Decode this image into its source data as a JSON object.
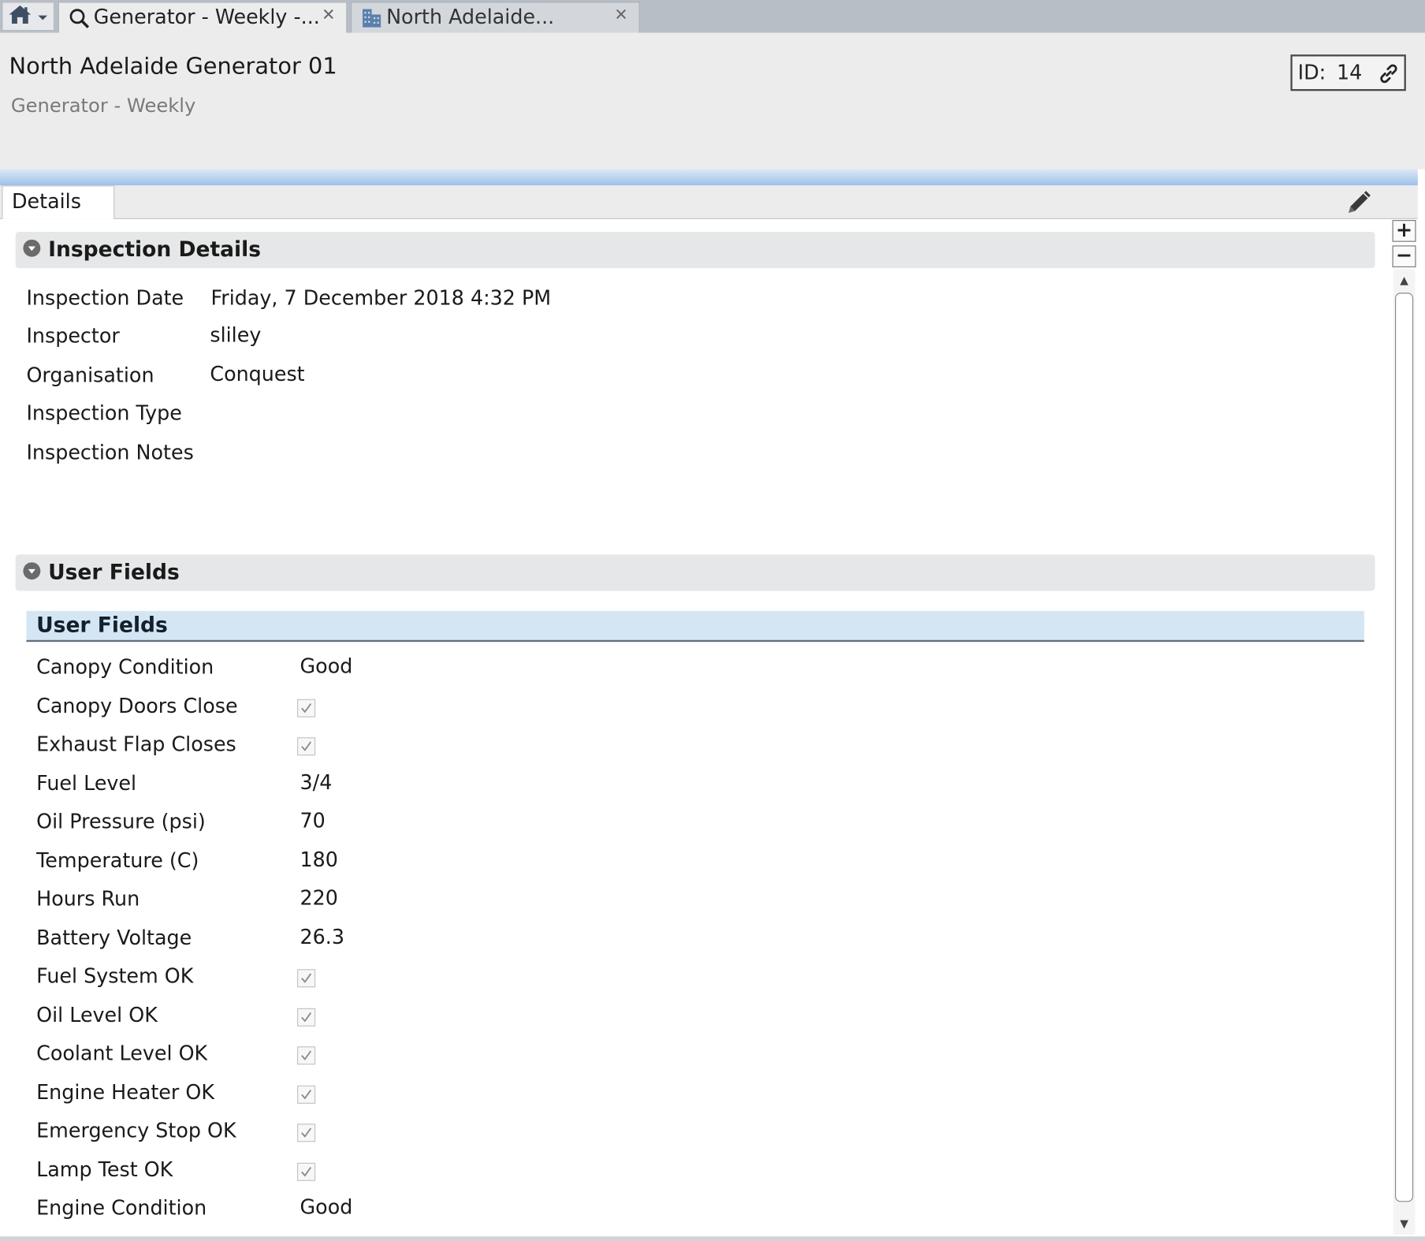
{
  "tabs": [
    {
      "label": "Generator - Weekly -...",
      "icon": "search-icon"
    },
    {
      "label": "North Adelaide...",
      "icon": "building-icon"
    }
  ],
  "header": {
    "title": "North Adelaide Generator 01",
    "subtitle": "Generator - Weekly",
    "id_label": "ID:",
    "id_value": "14"
  },
  "subtabs": {
    "details": "Details"
  },
  "zoom": {
    "plus": "+",
    "minus": "−"
  },
  "inspection": {
    "title": "Inspection Details",
    "fields": [
      {
        "label": "Inspection Date",
        "value": "Friday, 7 December 2018 4:32 PM"
      },
      {
        "label": "Inspector",
        "value": "sliley"
      },
      {
        "label": "Organisation",
        "value": "Conquest"
      },
      {
        "label": "Inspection Type",
        "value": ""
      },
      {
        "label": "Inspection Notes",
        "value": ""
      }
    ]
  },
  "user_fields": {
    "title": "User Fields",
    "group_title": "User Fields",
    "fields": [
      {
        "label": "Canopy Condition",
        "value": "Good",
        "type": "text"
      },
      {
        "label": "Canopy Doors Close",
        "value": "checked",
        "type": "checkbox"
      },
      {
        "label": "Exhaust Flap Closes",
        "value": "checked",
        "type": "checkbox"
      },
      {
        "label": "Fuel Level",
        "value": "3/4",
        "type": "text"
      },
      {
        "label": "Oil Pressure (psi)",
        "value": "70",
        "type": "text"
      },
      {
        "label": "Temperature (C)",
        "value": "180",
        "type": "text"
      },
      {
        "label": "Hours Run",
        "value": "220",
        "type": "text"
      },
      {
        "label": "Battery Voltage",
        "value": "26.3",
        "type": "text"
      },
      {
        "label": "Fuel System OK",
        "value": "checked",
        "type": "checkbox"
      },
      {
        "label": "Oil Level OK",
        "value": "checked",
        "type": "checkbox"
      },
      {
        "label": "Coolant Level OK",
        "value": "checked",
        "type": "checkbox"
      },
      {
        "label": "Engine Heater OK",
        "value": "checked",
        "type": "checkbox"
      },
      {
        "label": "Emergency Stop OK",
        "value": "checked",
        "type": "checkbox"
      },
      {
        "label": "Lamp Test OK",
        "value": "checked",
        "type": "checkbox"
      },
      {
        "label": "Engine Condition",
        "value": "Good",
        "type": "text"
      }
    ]
  },
  "colors": {
    "accent_gradient_top": "#dde8f4",
    "accent_gradient_bottom": "#9cc0e8",
    "group_header_bg": "#d4e6f4"
  }
}
